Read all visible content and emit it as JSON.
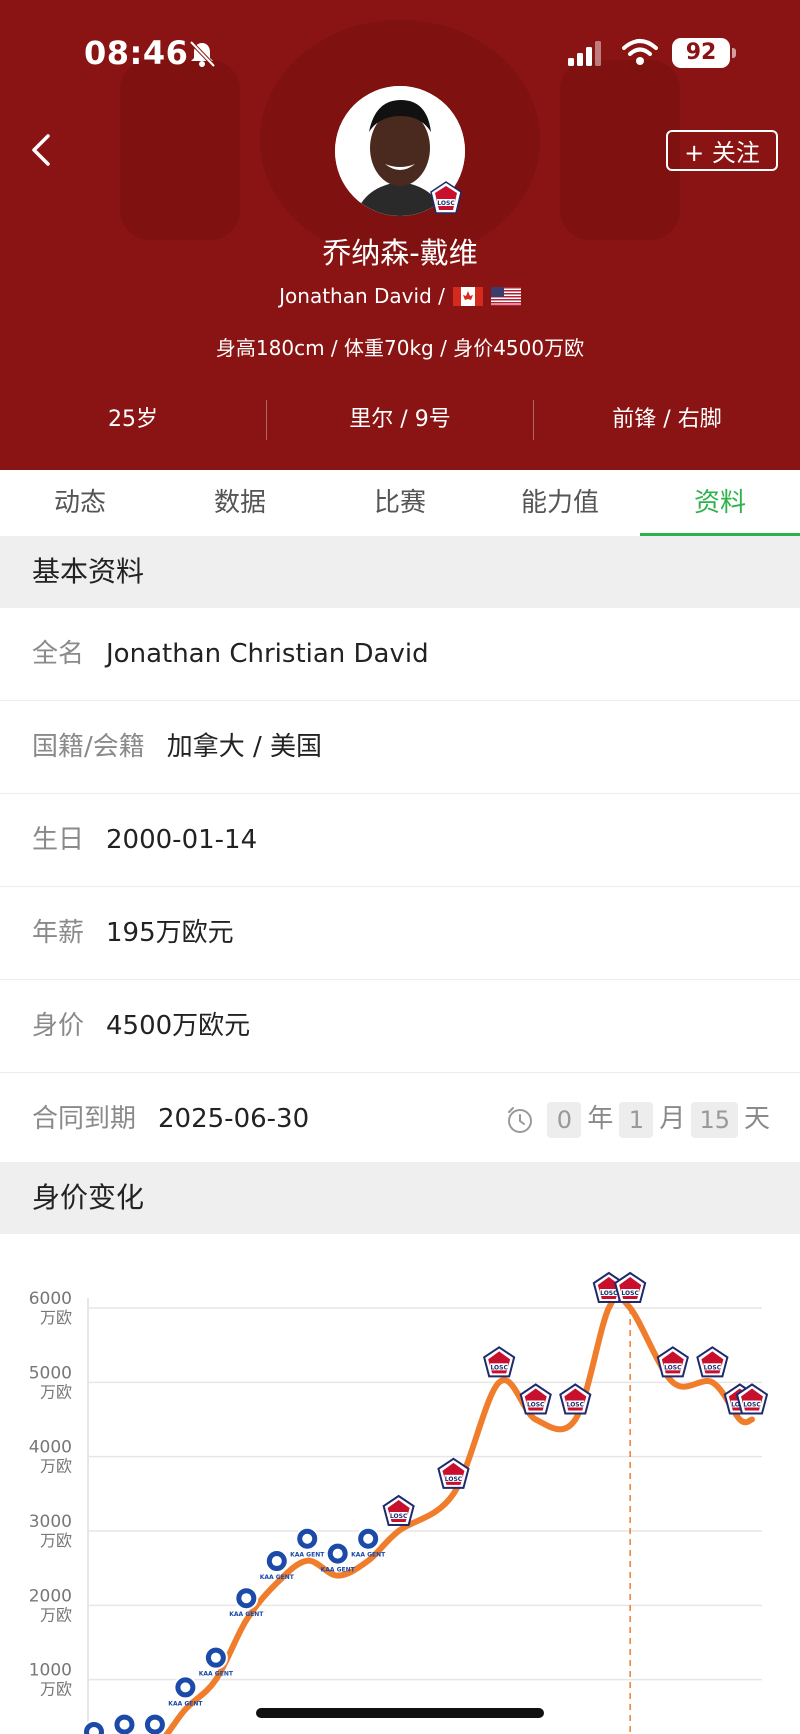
{
  "status_bar": {
    "time": "08:46",
    "battery": "92"
  },
  "header": {
    "follow_label": "+ 关注",
    "name_cn": "乔纳森-戴维",
    "name_en": "Jonathan David /",
    "stats": "身高180cm / 体重70kg / 身价4500万欧",
    "age": "25岁",
    "club": "里尔 / 9号",
    "position": "前锋 / 右脚",
    "colors": {
      "hero_bg": "#8a1313",
      "accent": "#2db34a"
    }
  },
  "tabs": [
    {
      "label": "动态",
      "active": false
    },
    {
      "label": "数据",
      "active": false
    },
    {
      "label": "比赛",
      "active": false
    },
    {
      "label": "能力值",
      "active": false
    },
    {
      "label": "资料",
      "active": true
    }
  ],
  "basic_info": {
    "title": "基本资料",
    "rows": [
      {
        "label": "全名",
        "value": "Jonathan Christian David"
      },
      {
        "label": "国籍/会籍",
        "value": "加拿大 / 美国"
      },
      {
        "label": "生日",
        "value": "2000-01-14"
      },
      {
        "label": "年薪",
        "value": "195万欧元"
      },
      {
        "label": "身价",
        "value": "4500万欧元"
      }
    ],
    "contract": {
      "label": "合同到期",
      "value": "2025-06-30",
      "years": "0",
      "years_unit": "年",
      "months": "1",
      "months_unit": "月",
      "days": "15",
      "days_unit": "天"
    }
  },
  "value_section": {
    "title": "身价变化"
  },
  "chart_data": {
    "type": "line",
    "ylim": [
      0,
      6000
    ],
    "y_ticks": [
      {
        "value": 6000,
        "label": "6000",
        "unit": "万欧"
      },
      {
        "value": 5000,
        "label": "5000",
        "unit": "万欧"
      },
      {
        "value": 4000,
        "label": "4000",
        "unit": "万欧"
      },
      {
        "value": 3000,
        "label": "3000",
        "unit": "万欧"
      },
      {
        "value": 2000,
        "label": "2000",
        "unit": "万欧"
      },
      {
        "value": 1000,
        "label": "1000",
        "unit": "万欧"
      }
    ],
    "series": [
      {
        "color": "#ef7d2c",
        "points": [
          {
            "x": 0,
            "y": 0,
            "club": "KAA GENT"
          },
          {
            "x": 1,
            "y": 100,
            "club": "KAA GENT"
          },
          {
            "x": 2,
            "y": 100,
            "club": "KAA GENT"
          },
          {
            "x": 3,
            "y": 600,
            "club": "KAA GENT"
          },
          {
            "x": 4,
            "y": 1000,
            "club": "KAA GENT"
          },
          {
            "x": 5,
            "y": 1800,
            "club": "KAA GENT"
          },
          {
            "x": 6,
            "y": 2300,
            "club": "KAA GENT"
          },
          {
            "x": 7,
            "y": 2600,
            "club": "KAA GENT"
          },
          {
            "x": 8,
            "y": 2400,
            "club": "KAA GENT"
          },
          {
            "x": 9,
            "y": 2600,
            "club": "KAA GENT"
          },
          {
            "x": 10,
            "y": 3000,
            "club": "LOSC"
          },
          {
            "x": 11.8,
            "y": 3500,
            "club": "LOSC"
          },
          {
            "x": 13.3,
            "y": 5000,
            "club": "LOSC"
          },
          {
            "x": 14.5,
            "y": 4500,
            "club": "LOSC"
          },
          {
            "x": 15.8,
            "y": 4500,
            "club": "LOSC"
          },
          {
            "x": 16.9,
            "y": 6000,
            "club": "LOSC"
          },
          {
            "x": 17.6,
            "y": 6000,
            "club": "LOSC"
          },
          {
            "x": 19,
            "y": 5000,
            "club": "LOSC"
          },
          {
            "x": 20.3,
            "y": 5000,
            "club": "LOSC"
          },
          {
            "x": 21.2,
            "y": 4500,
            "club": "LOSC"
          },
          {
            "x": 21.6,
            "y": 4500,
            "club": "LOSC"
          }
        ]
      }
    ],
    "highlight_x": 17.6
  }
}
